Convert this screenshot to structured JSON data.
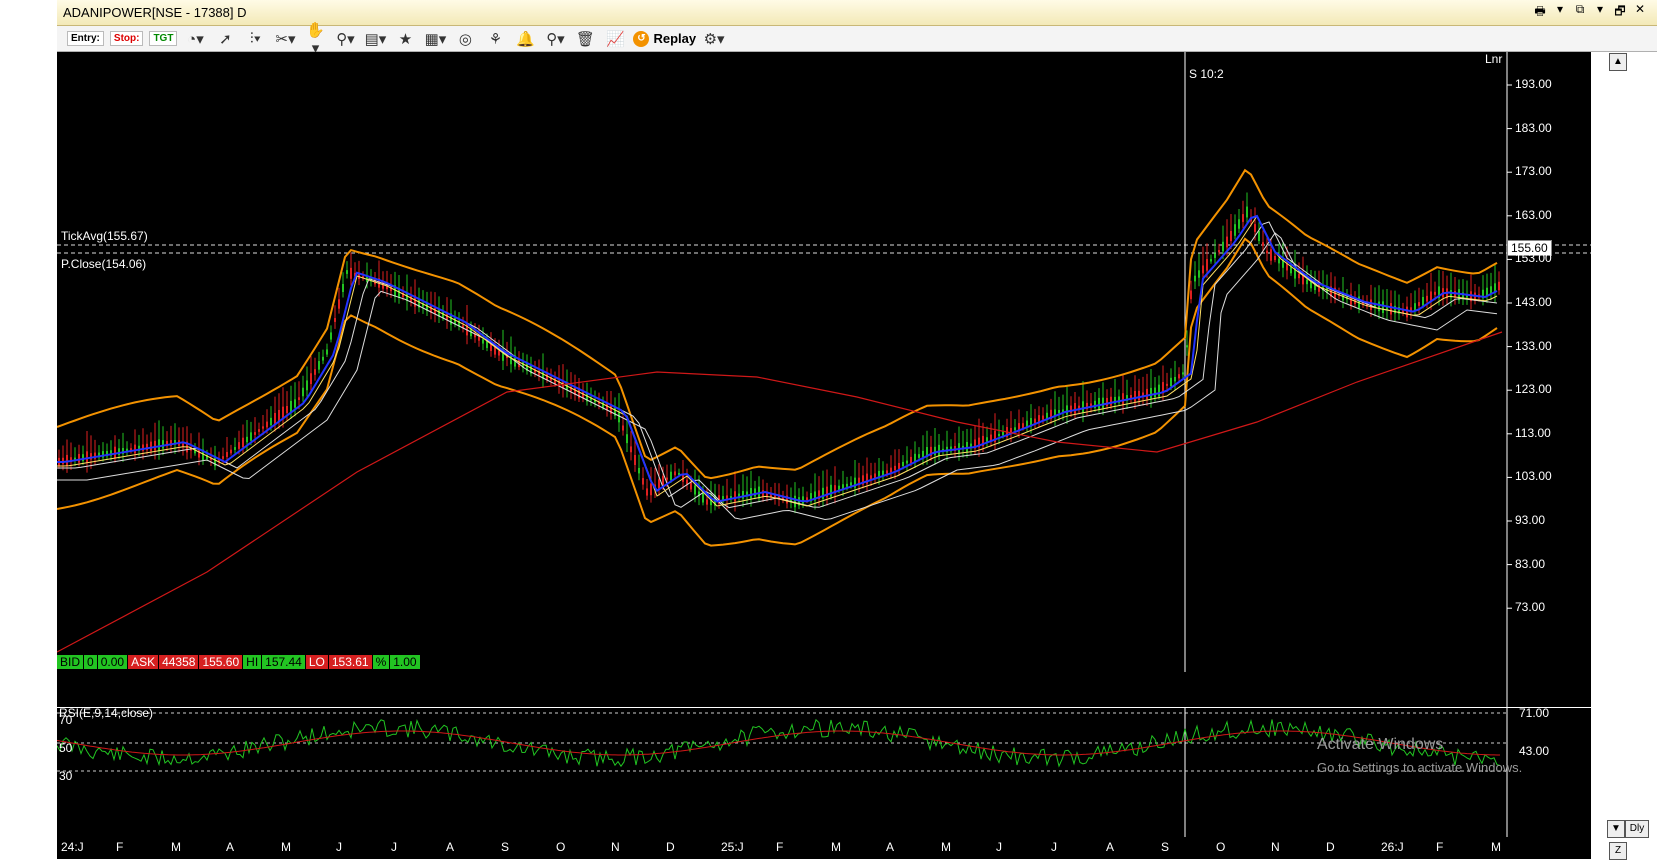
{
  "window": {
    "title": "ADANIPOWER[NSE - 17388] D",
    "controls": [
      "🖶",
      "▾",
      "⧉",
      "▾",
      "🗗",
      "✕"
    ]
  },
  "toolbar": {
    "entry_label": "Entry:",
    "stop_label": "Stop:",
    "tgt_label": "TGT",
    "replay_label": "Replay",
    "icons": [
      "chart-type-icon",
      "cursor-icon",
      "bar-icon",
      "drawing-icon",
      "hand-icon",
      "link-icon",
      "book-icon",
      "star-icon",
      "layout-icon",
      "analysis-icon",
      "scanner-icon",
      "alert-icon",
      "zoom-icon",
      "trash-icon",
      "trend-icon",
      "settings-icon"
    ]
  },
  "chart": {
    "mode_label": "Lnr",
    "crosshair_label": "S 10:2",
    "tick_avg_label": "TickAvg(155.67)",
    "prev_close_label": "P.Close(154.06)",
    "current_price": "155.60",
    "price_axis": [
      "193.00",
      "183.00",
      "173.00",
      "163.00",
      "153.00",
      "143.00",
      "133.00",
      "123.00",
      "113.00",
      "103.00",
      "93.00",
      "83.00",
      "73.00"
    ],
    "colors": {
      "background": "#000000",
      "up_candle": "#22c422",
      "down_candle": "#e02020",
      "bollinger": "#f39200",
      "sma_fast": "#2233ff",
      "sma_slow": "#d01818",
      "envelope": "#dddddd",
      "ma_yellow": "#ffe066"
    }
  },
  "quote": {
    "bid_label": "BID",
    "bid_qty": "0",
    "bid_price": "0.00",
    "ask_label": "ASK",
    "ask_qty": "44358",
    "ask_price": "155.60",
    "hi_label": "HI",
    "hi_value": "157.44",
    "lo_label": "LO",
    "lo_value": "153.61",
    "pct_label": "%",
    "pct_value": "1.00"
  },
  "rsi": {
    "title": "RSI(E,9,14,close)",
    "left_levels": [
      "70",
      "50",
      "30"
    ],
    "right_levels": [
      "71.00",
      "43.00"
    ],
    "line_color": "#22c422",
    "signal_color": "#d01818"
  },
  "xaxis": {
    "labels": [
      "24:J",
      "F",
      "M",
      "A",
      "M",
      "J",
      "J",
      "A",
      "S",
      "O",
      "N",
      "D",
      "25:J",
      "F",
      "M",
      "A",
      "M",
      "J",
      "J",
      "A",
      "S",
      "O",
      "N",
      "D",
      "26:J",
      "F",
      "M"
    ]
  },
  "watermark": {
    "line1": "Activate Windows",
    "line2": "Go to Settings to activate Windows."
  },
  "side": {
    "z_label": "Z",
    "dly_label": "Dly"
  }
}
